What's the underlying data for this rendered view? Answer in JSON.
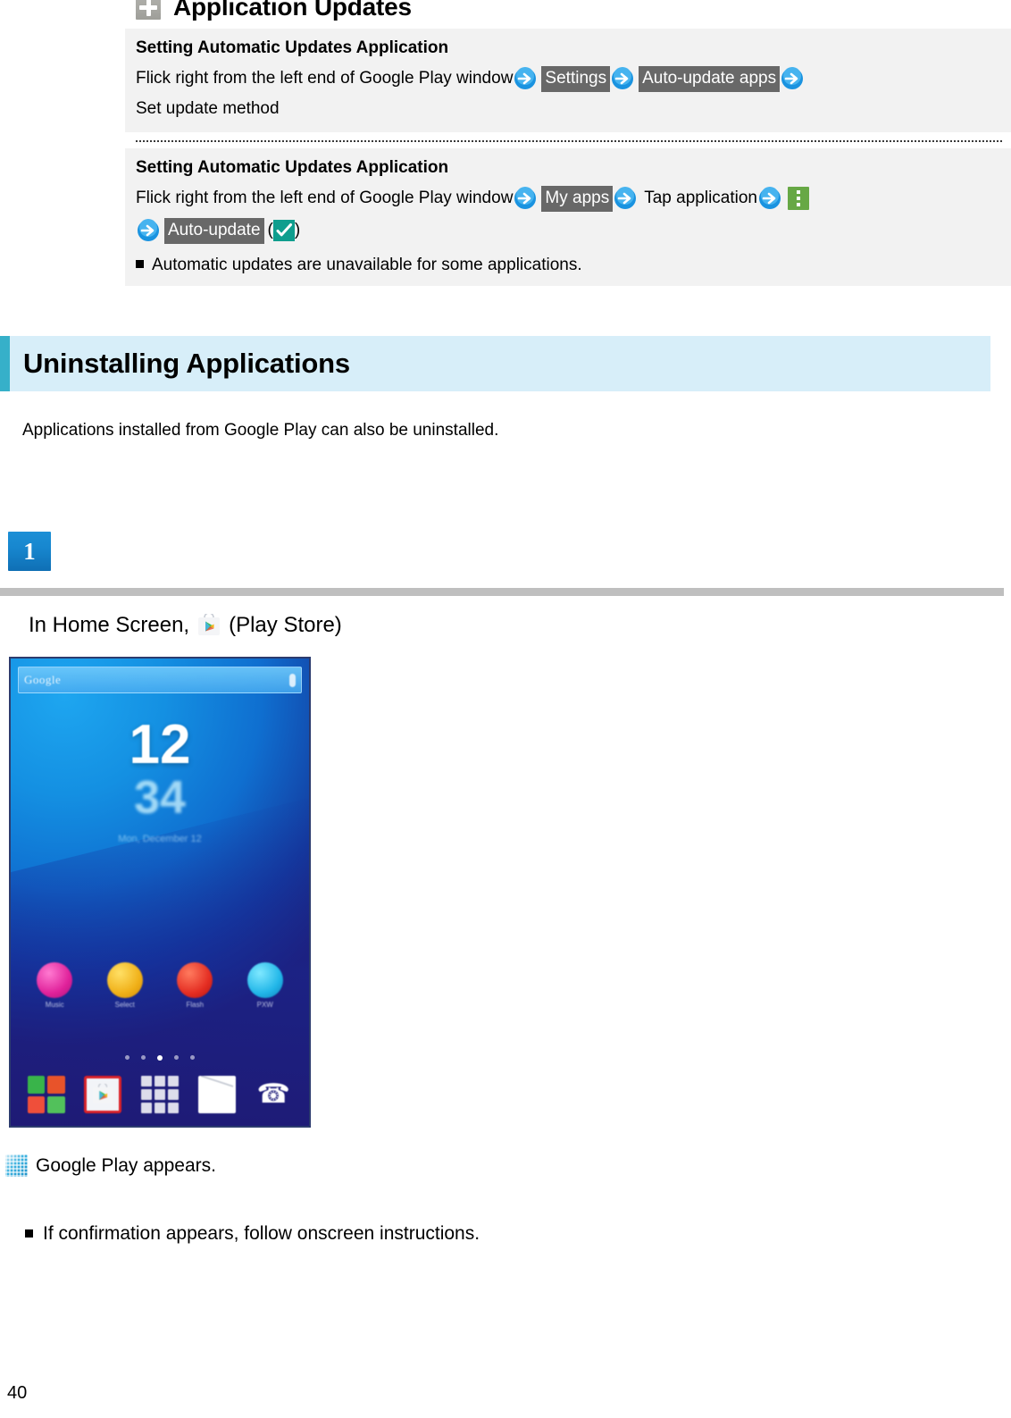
{
  "document": {
    "page_number": "40"
  },
  "top_section": {
    "icon": "plus-box-icon",
    "title": "Application Updates",
    "boxes": [
      {
        "title": "Setting Automatic Updates Application",
        "line_prefix": "Flick right from the left end of Google Play window",
        "key1": "Settings",
        "key2": "Auto-update apps",
        "trailing": "Set update method",
        "arrow_icon": "blue-arrow-icon"
      },
      {
        "title": "Setting Automatic Updates Application",
        "line_prefix": "Flick right from the left end of Google Play window",
        "key1": "My apps",
        "mid_text": "Tap application",
        "menu_icon": "green-overflow-menu-icon",
        "key2": "Auto-update",
        "paren_open": "(",
        "paren_close": ")",
        "check_icon": "teal-checkbox-icon",
        "note": "Automatic updates are unavailable for some applications.",
        "arrow_icon": "blue-arrow-icon"
      }
    ]
  },
  "section": {
    "banner_title": "Uninstalling Applications",
    "accent_color": "#36b0c9",
    "banner_bg": "#d7eef9",
    "description": "Applications installed from Google Play can also be uninstalled."
  },
  "step": {
    "badge_number": "1",
    "instruction_prefix": "In Home Screen,",
    "instruction_suffix": "(Play Store)",
    "icon": "play-store-icon"
  },
  "phone_screenshot": {
    "search_text": "Google",
    "clock_hour": "12",
    "clock_sub": "34",
    "clock_date": "Mon, December 12",
    "apps": [
      {
        "label": "Music",
        "icon": "music-icon"
      },
      {
        "label": "Select",
        "icon": "select-icon"
      },
      {
        "label": "Flash",
        "icon": "flash-icon"
      },
      {
        "label": "PXW",
        "icon": "pxw-icon"
      }
    ],
    "page_dots": 5,
    "active_dot_index": 2,
    "dock": [
      {
        "name": "widgets-icon"
      },
      {
        "name": "play-store-icon-highlighted"
      },
      {
        "name": "app-drawer-icon"
      },
      {
        "name": "mail-icon"
      },
      {
        "name": "phone-icon"
      }
    ]
  },
  "result": {
    "icon": "screen-thumbnail-icon",
    "text": "Google Play appears.",
    "bullet": "If confirmation appears, follow onscreen instructions."
  }
}
